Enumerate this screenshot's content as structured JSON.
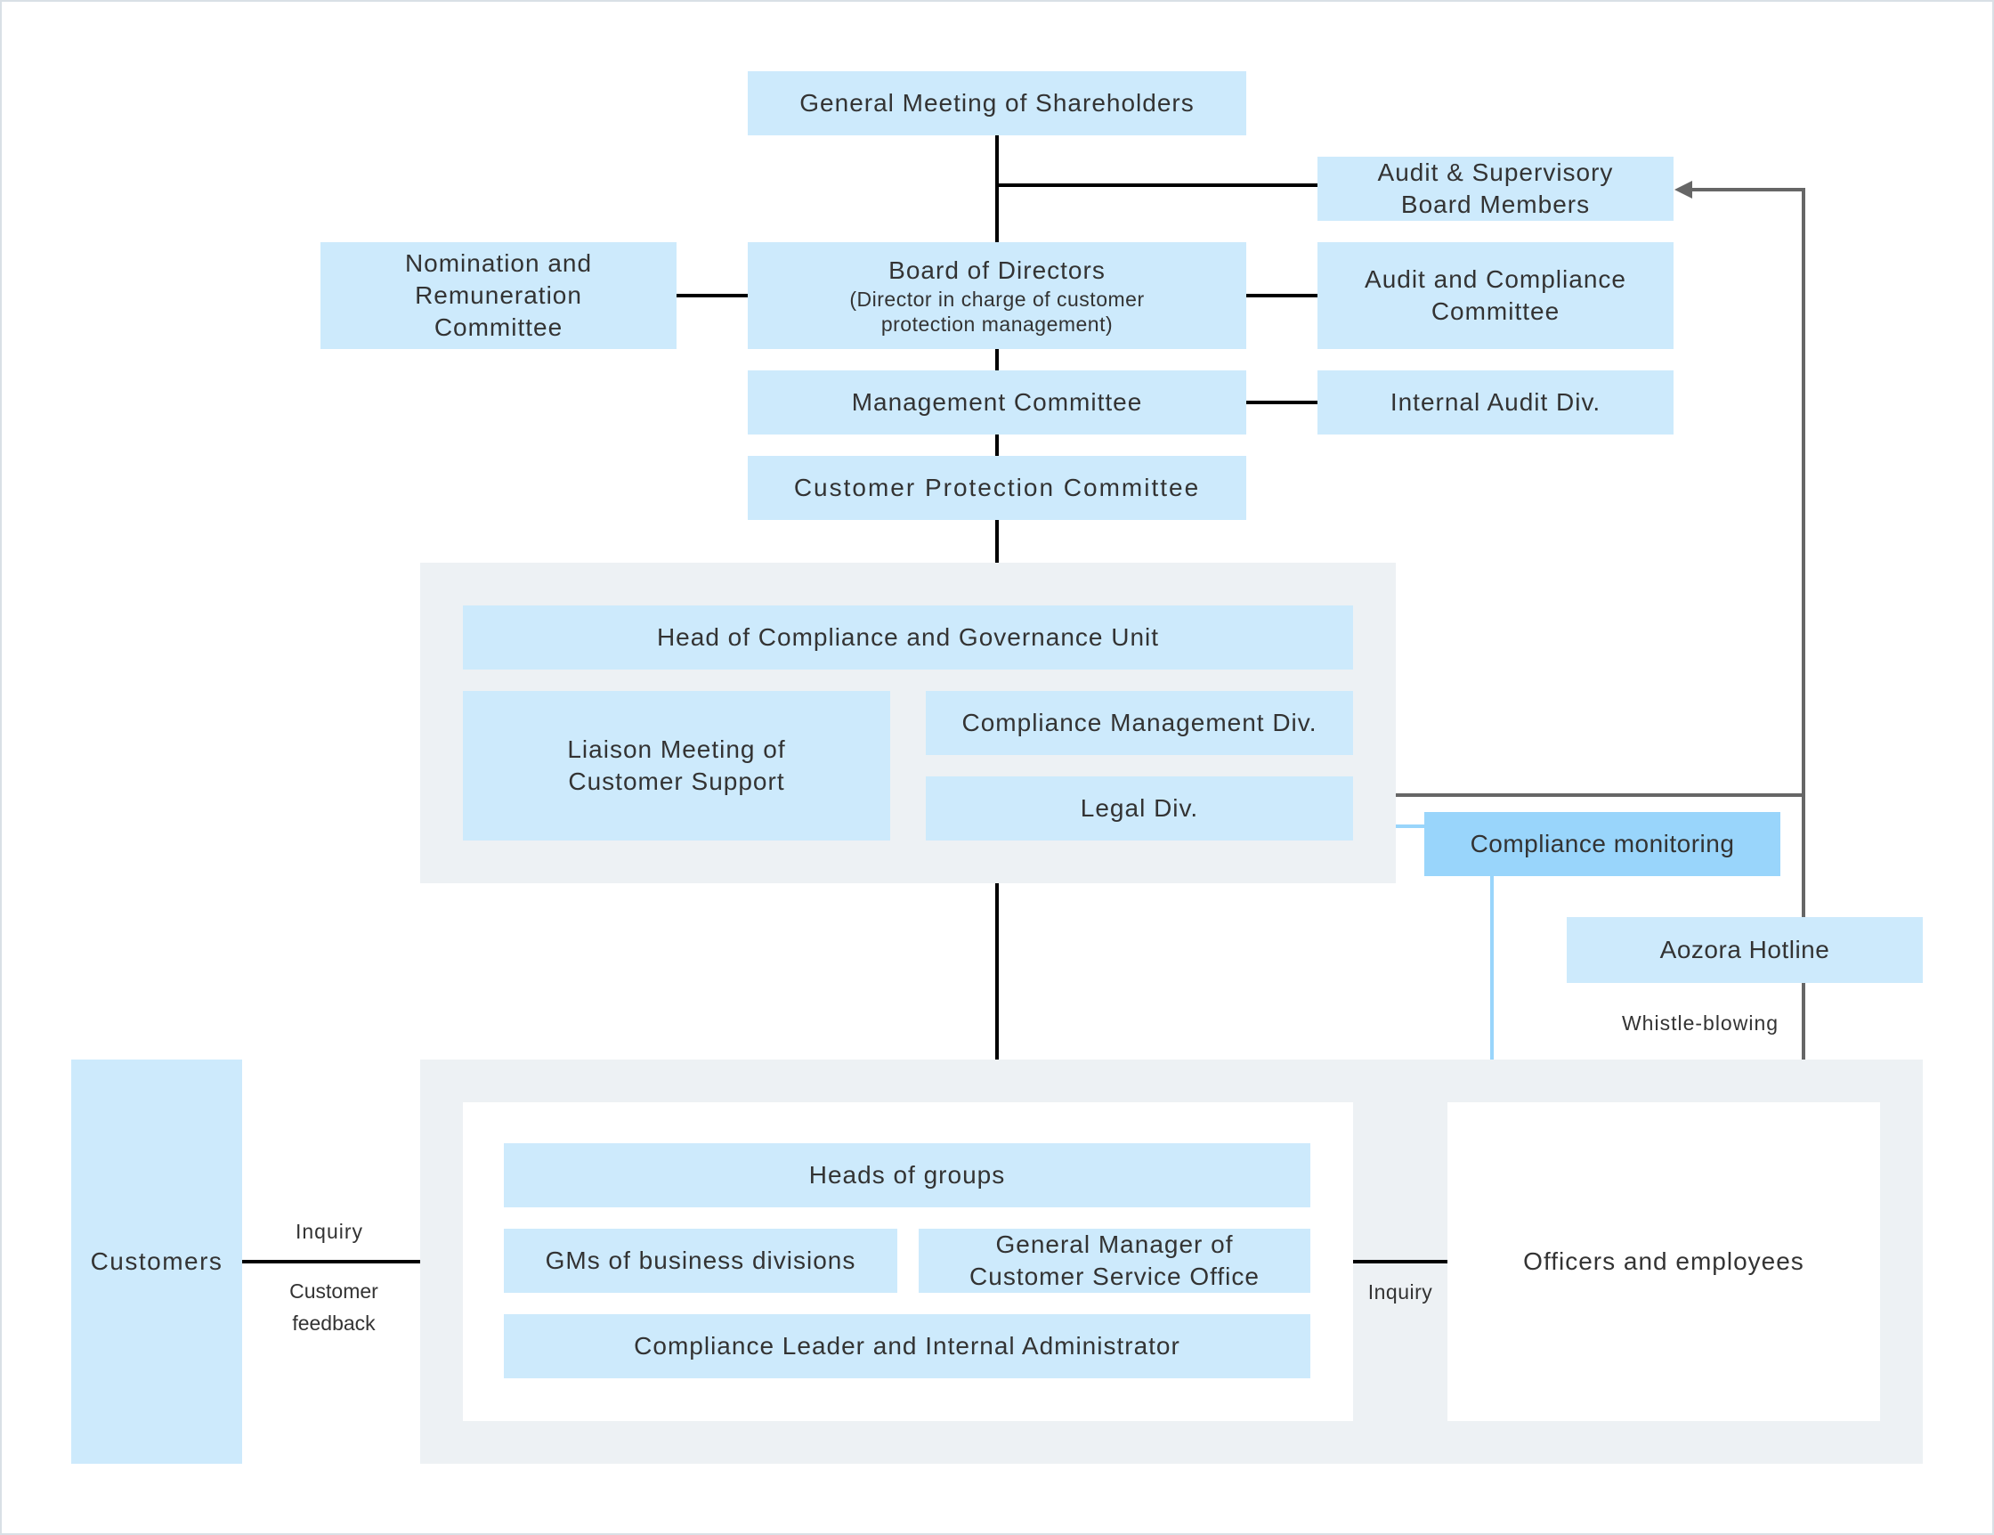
{
  "colors": {
    "box_fill": "#cdeafc",
    "highlight_fill": "#99d5fb",
    "group_fill": "#edf1f4",
    "connector": "#000000",
    "report_arrow": "#666666",
    "monitoring_line": "#99d5fb",
    "text": "#333333"
  },
  "top": {
    "general_meeting": "General Meeting of Shareholders",
    "audit_supervisory": [
      "Audit & Supervisory",
      "Board Members"
    ],
    "nomination_committee": [
      "Nomination and",
      "Remuneration",
      "Committee"
    ],
    "board_of_directors": {
      "title": "Board of Directors",
      "subtitle": [
        "(Director in charge of customer",
        "protection management)"
      ]
    },
    "audit_compliance_committee": [
      "Audit and Compliance",
      "Committee"
    ],
    "management_committee": "Management Committee",
    "internal_audit": "Internal Audit Div.",
    "customer_protection_committee": "Customer Protection Committee"
  },
  "compliance_unit": {
    "head": "Head of Compliance and Governance Unit",
    "liaison_meeting": [
      "Liaison Meeting of",
      "Customer Support"
    ],
    "compliance_management_div": "Compliance Management Div.",
    "legal_div": "Legal Div."
  },
  "side": {
    "compliance_monitoring": "Compliance monitoring",
    "hotline": "Aozora Hotline",
    "whistle_blowing": "Whistle-blowing"
  },
  "business": {
    "customers": "Customers",
    "inquiry_label": "Inquiry",
    "feedback_label": [
      "Customer",
      "feedback"
    ],
    "heads_of_groups": "Heads of groups",
    "gms_business_divisions": "GMs of business divisions",
    "gm_customer_service": [
      "General Manager of",
      "Customer Service Office"
    ],
    "compliance_leader": "Compliance Leader and Internal Administrator",
    "inquiry_label_2": "Inquiry",
    "officers_employees": "Officers and employees"
  }
}
